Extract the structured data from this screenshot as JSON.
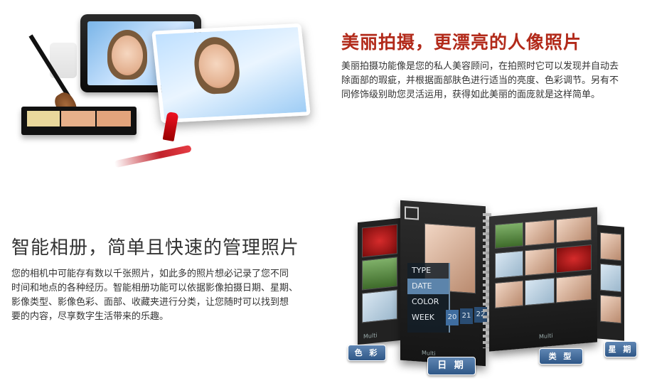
{
  "section1": {
    "title": "美丽拍摄，更漂亮的人像照片",
    "lines": [
      "美丽拍摄功能像是您的私人美容顾问，在拍照时它可以发现并自动去",
      "除面部的瑕疵，并根据面部肤色进行适当的亮度、色彩调节。另有不",
      "同修饰级别助您灵活运用，获得如此美丽的面庞就是这样简单。"
    ]
  },
  "section2": {
    "title": "智能相册，简单且快速的管理照片",
    "lines": [
      "您的相机中可能存有数以千张照片，如此多的照片想必记录了您不同",
      "时间和地点的各种经历。智能相册功能可以依据影像拍摄日期、星期、",
      "影像类型、影像色彩、面部、收藏夹进行分类，让您随时可以找到想",
      "要的内容，尽享数字生活带来的乐趣。"
    ]
  },
  "album": {
    "menu": [
      "TYPE",
      "DATE",
      "COLOR",
      "WEEK"
    ],
    "days": [
      "20",
      "21",
      "22"
    ],
    "multi": "Multi",
    "tags": {
      "color": "色 彩",
      "date": "日 期",
      "type": "类 型",
      "week": "星 期"
    }
  },
  "colors": {
    "title1": "#b22a1a",
    "title2": "#333333",
    "tag": "#3d6796",
    "menu_selected": "#5c84ab"
  }
}
